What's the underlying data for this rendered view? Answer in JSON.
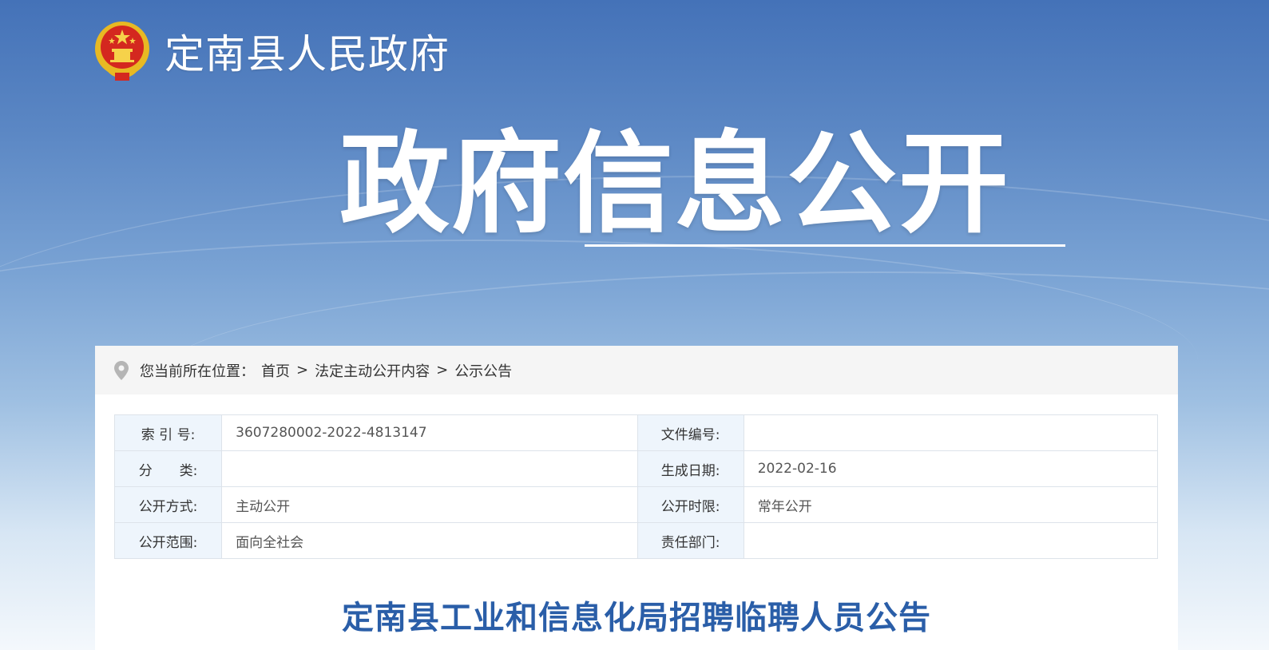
{
  "header": {
    "site_name": "定南县人民政府"
  },
  "banner": {
    "title": "政府信息公开"
  },
  "breadcrumb": {
    "prefix": "您当前所在位置：",
    "items": [
      "首页",
      "法定主动公开内容",
      "公示公告"
    ],
    "separator": ">"
  },
  "info_table": {
    "rows": [
      {
        "label1": "索 引 号:",
        "value1": "3607280002-2022-4813147",
        "label2": "文件编号:",
        "value2": ""
      },
      {
        "label1": "分　　类:",
        "value1": "",
        "label2": "生成日期:",
        "value2": "2022-02-16"
      },
      {
        "label1": "公开方式:",
        "value1": "主动公开",
        "label2": "公开时限:",
        "value2": "常年公开"
      },
      {
        "label1": "公开范围:",
        "value1": "面向全社会",
        "label2": "责任部门:",
        "value2": ""
      }
    ]
  },
  "document": {
    "title": "定南县工业和信息化局招聘临聘人员公告"
  },
  "colors": {
    "title_blue": "#2a5ea8",
    "label_bg": "#eef5fc",
    "breadcrumb_bg": "#f5f5f5"
  }
}
